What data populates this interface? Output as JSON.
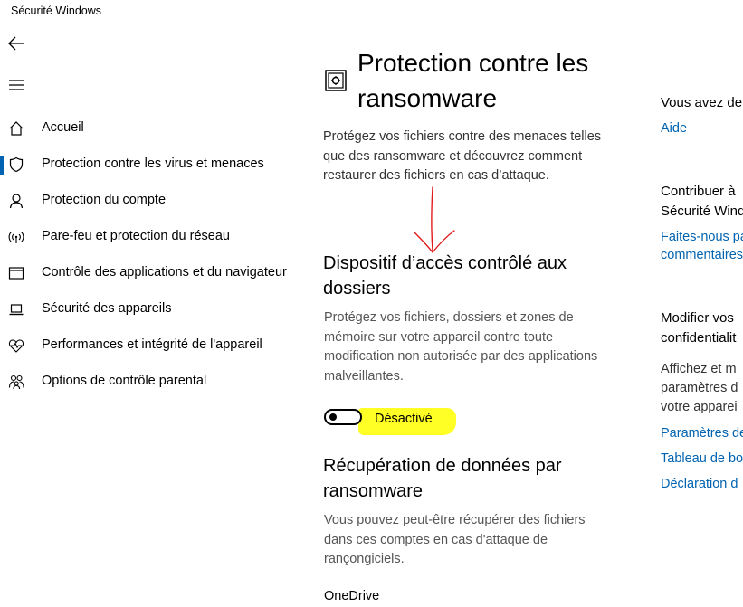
{
  "window": {
    "title": "Sécurité Windows"
  },
  "sidebar": {
    "items": [
      {
        "label": "Accueil",
        "icon": "home-icon"
      },
      {
        "label": "Protection contre les virus et menaces",
        "icon": "shield-icon",
        "active": true
      },
      {
        "label": "Protection du compte",
        "icon": "person-icon"
      },
      {
        "label": "Pare-feu et protection du réseau",
        "icon": "wifi-icon"
      },
      {
        "label": "Contrôle des applications et du navigateur",
        "icon": "app-window-icon"
      },
      {
        "label": "Sécurité des appareils",
        "icon": "laptop-icon"
      },
      {
        "label": "Performances et intégrité de l'appareil",
        "icon": "heart-icon"
      },
      {
        "label": "Options de contrôle parental",
        "icon": "family-icon"
      }
    ]
  },
  "main": {
    "title": "Protection contre les ransomware",
    "intro": "Protégez vos fichiers contre des menaces telles que des ransomware et découvrez comment restaurer des fichiers en cas d’attaque.",
    "cfa": {
      "title": "Dispositif d’accès contrôlé aux dossiers",
      "description": "Protégez vos fichiers, dossiers et zones de mémoire sur votre appareil contre toute modification non autorisée par des applications malveillantes.",
      "toggle_label": "Désactivé",
      "toggle_on": false
    },
    "recovery": {
      "title": "Récupération de données par ransomware",
      "description": "Vous pouvez peut-être récupérer des fichiers dans ces comptes en cas d'attaque de rançongiciels.",
      "provider": "OneDrive"
    }
  },
  "right": {
    "question": {
      "heading": "Vous avez de",
      "link": "Aide"
    },
    "contribute": {
      "heading_line1": "Contribuer à",
      "heading_line2": "Sécurité Windo",
      "link_line1": "Faites-nous pa",
      "link_line2": "commentaires"
    },
    "privacy": {
      "heading_line1": "Modifier vos",
      "heading_line2": "confidentialit",
      "text_line1": "Affichez et m",
      "text_line2": "paramètres d",
      "text_line3": "votre apparei",
      "link1": "Paramètres de",
      "link2": "Tableau de bo",
      "link3": "Déclaration d"
    }
  },
  "colors": {
    "accent": "#0063b1",
    "highlight": "#ffff26",
    "annotation_arrow": "#e31b1b"
  }
}
